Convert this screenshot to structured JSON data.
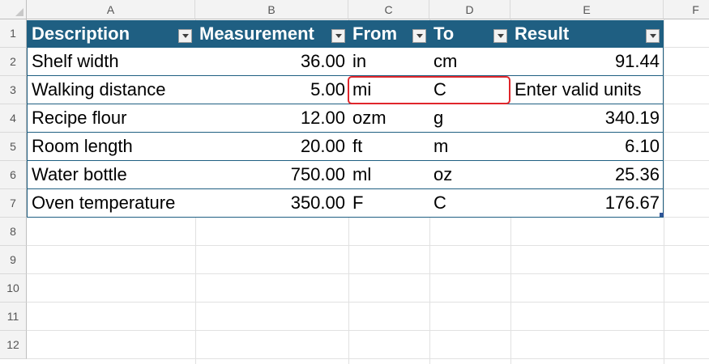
{
  "columns": [
    "A",
    "B",
    "C",
    "D",
    "E",
    "F"
  ],
  "rows": [
    "1",
    "2",
    "3",
    "4",
    "5",
    "6",
    "7",
    "8",
    "9",
    "10",
    "11",
    "12"
  ],
  "table": {
    "headers": [
      "Description",
      "Measurement",
      "From",
      "To",
      "Result"
    ],
    "rows": [
      {
        "description": "Shelf width",
        "measurement": "36.00",
        "from": "in",
        "to": "cm",
        "result": "91.44"
      },
      {
        "description": "Walking distance",
        "measurement": "5.00",
        "from": "mi",
        "to": "C",
        "result": "Enter valid units"
      },
      {
        "description": "Recipe flour",
        "measurement": "12.00",
        "from": "ozm",
        "to": "g",
        "result": "340.19"
      },
      {
        "description": "Room length",
        "measurement": "20.00",
        "from": "ft",
        "to": "m",
        "result": "6.10"
      },
      {
        "description": "Water bottle",
        "measurement": "750.00",
        "from": "ml",
        "to": "oz",
        "result": "25.36"
      },
      {
        "description": "Oven temperature",
        "measurement": "350.00",
        "from": "F",
        "to": "C",
        "result": "176.67"
      }
    ]
  },
  "colors": {
    "table_header": "#1f5f82",
    "error_outline": "#e0262b"
  }
}
